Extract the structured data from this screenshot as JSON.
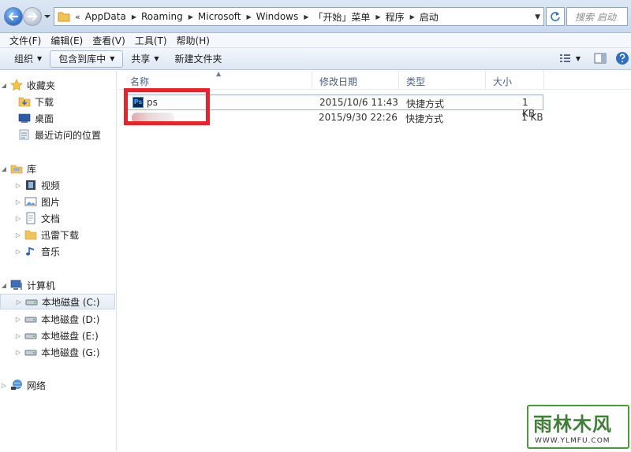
{
  "address_bar": {
    "overflow_marker": "«",
    "breadcrumbs": [
      "AppData",
      "Roaming",
      "Microsoft",
      "Windows",
      "「开始」菜单",
      "程序",
      "启动"
    ],
    "search_placeholder": "搜索 启动"
  },
  "menu": [
    "文件(F)",
    "编辑(E)",
    "查看(V)",
    "工具(T)",
    "帮助(H)"
  ],
  "toolbar": {
    "organize": "组织",
    "include_in_library": "包含到库中",
    "share": "共享",
    "new_folder": "新建文件夹"
  },
  "nav": {
    "favorites": {
      "label": "收藏夹",
      "items": [
        "下载",
        "桌面",
        "最近访问的位置"
      ]
    },
    "libraries": {
      "label": "库",
      "items": [
        "视频",
        "图片",
        "文档",
        "迅雷下载",
        "音乐"
      ]
    },
    "computer": {
      "label": "计算机",
      "items": [
        "本地磁盘 (C:)",
        "本地磁盘 (D:)",
        "本地磁盘 (E:)",
        "本地磁盘 (G:)"
      ]
    },
    "network": {
      "label": "网络"
    }
  },
  "file_list": {
    "headers": {
      "name": "名称",
      "modified": "修改日期",
      "type": "类型",
      "size": "大小"
    },
    "rows": [
      {
        "name": "ps",
        "modified": "2015/10/6 11:43",
        "type": "快捷方式",
        "size": "1 KB"
      },
      {
        "name": "",
        "modified": "2015/9/30 22:26",
        "type": "快捷方式",
        "size": "1 KB"
      }
    ]
  },
  "watermark": {
    "title": "雨林木风",
    "url": "WWW.YLMFU.COM"
  },
  "colors": {
    "highlight": "#e8232b",
    "accent": "#2f6fc4"
  }
}
